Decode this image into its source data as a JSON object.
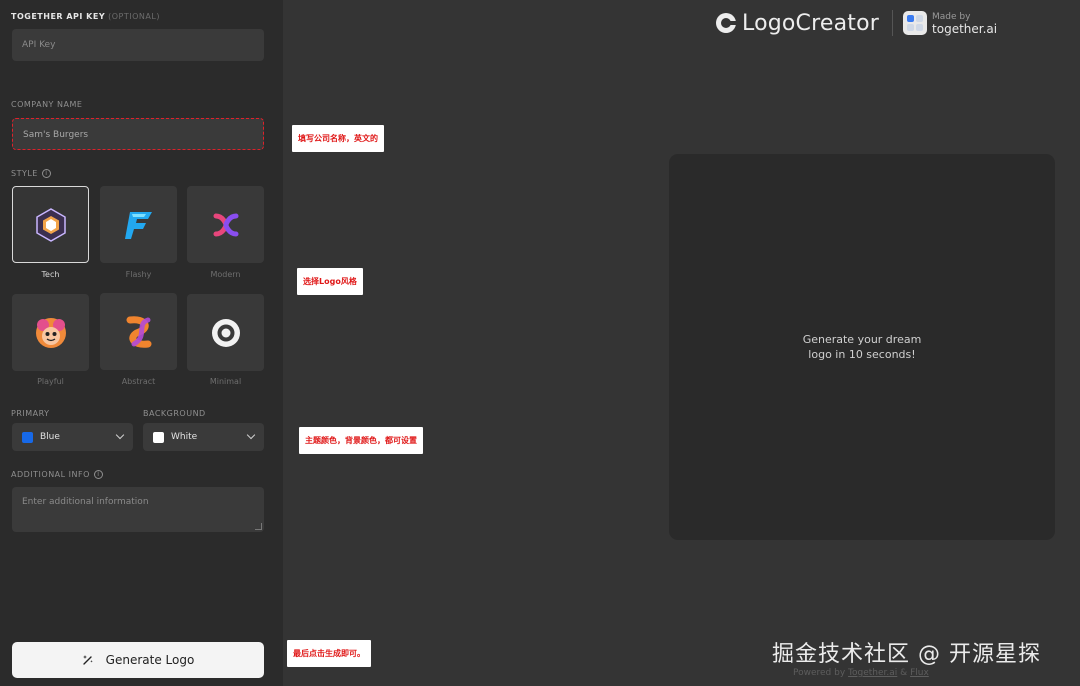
{
  "sidebar": {
    "api_key": {
      "label": "TOGETHER API KEY",
      "optional": "(OPTIONAL)",
      "placeholder": "API Key"
    },
    "company": {
      "label": "COMPANY NAME",
      "value": "Sam's Burgers"
    },
    "style": {
      "label": "STYLE",
      "options": [
        {
          "name": "Tech",
          "icon": "tech-hexagon-icon",
          "selected": true
        },
        {
          "name": "Flashy",
          "icon": "flashy-f-icon",
          "selected": false
        },
        {
          "name": "Modern",
          "icon": "modern-x-icon",
          "selected": false
        },
        {
          "name": "Playful",
          "icon": "playful-mascot-icon",
          "selected": false
        },
        {
          "name": "Abstract",
          "icon": "abstract-knot-icon",
          "selected": false
        },
        {
          "name": "Minimal",
          "icon": "minimal-circle-icon",
          "selected": false
        }
      ]
    },
    "primary": {
      "label": "PRIMARY",
      "value": "Blue",
      "color": "#1769e8"
    },
    "background": {
      "label": "BACKGROUND",
      "value": "White",
      "color": "#ffffff"
    },
    "additional": {
      "label": "ADDITIONAL INFO",
      "placeholder": "Enter additional information"
    },
    "generate_label": "Generate Logo"
  },
  "annotations": {
    "company": "填写公司名称，英文的",
    "style": "选择Logo风格",
    "colors": "主题颜色，背景颜色，都可设置",
    "generate": "最后点击生成即可。"
  },
  "header": {
    "brand_name": "LogoCreator",
    "made_by": "Made by",
    "partner": "together.ai"
  },
  "canvas": {
    "line1": "Generate your dream",
    "line2": "logo in 10 seconds!"
  },
  "footer": {
    "powered_prefix": "Powered by",
    "link1": "Together.ai",
    "amp": "&",
    "link2": "Flux"
  },
  "watermark": "掘金技术社区 @ 开源星探"
}
